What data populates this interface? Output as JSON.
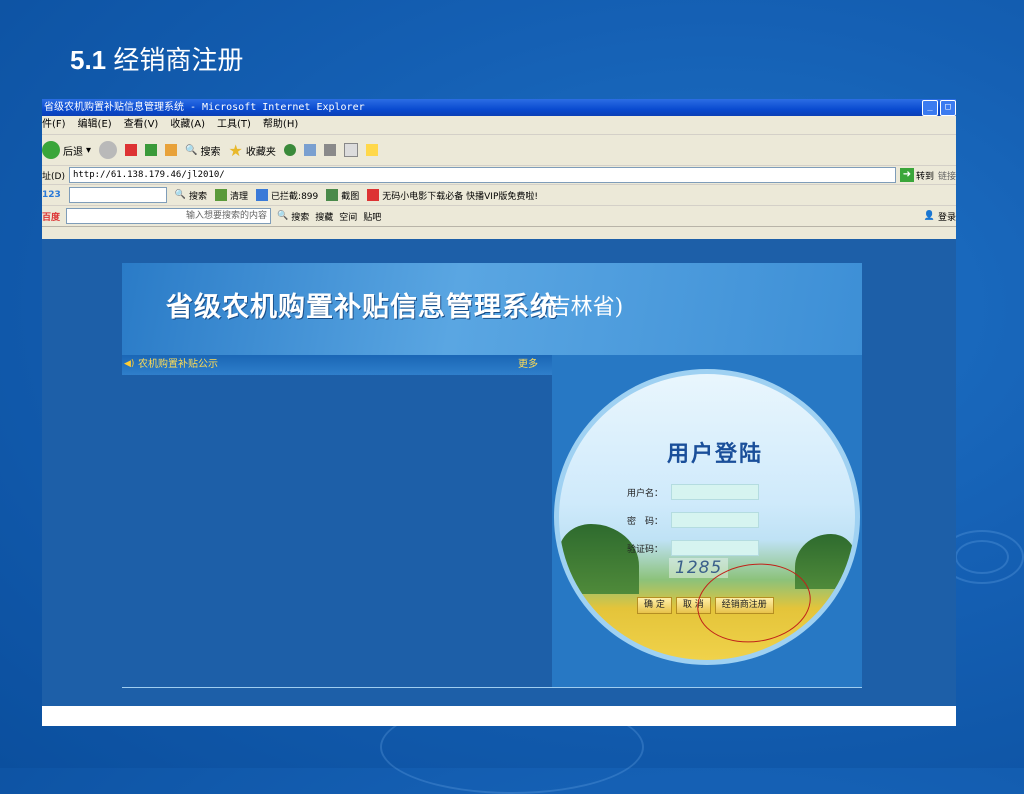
{
  "slide": {
    "title_num": "5.1",
    "title_text": "经销商注册"
  },
  "browser": {
    "window_title": "省级农机购置补贴信息管理系统 - Microsoft Internet Explorer",
    "menu": [
      "件(F)",
      "编辑(E)",
      "查看(V)",
      "收藏(A)",
      "工具(T)",
      "帮助(H)"
    ],
    "toolbar": {
      "back": "后退",
      "search": "搜索",
      "favorites": "收藏夹"
    },
    "address": {
      "label": "址(D)",
      "url": "http://61.138.179.46/jl2010/",
      "go": "转到",
      "links": "链接"
    },
    "bar3": {
      "search": "搜索",
      "clean": "清理",
      "blocked": "已拦截:899",
      "screenshot": "截图",
      "promo": "无码小电影下载必备 快播VIP版免费啦!"
    },
    "bar4": {
      "placeholder": "输入想要搜索的内容",
      "search": "搜索",
      "collect": "搜藏",
      "space": "空间",
      "tieba": "贴吧",
      "login": "登录"
    }
  },
  "page": {
    "banner_title": "省级农机购置补贴信息管理系统",
    "banner_province": "(吉林省)",
    "notice_label": "农机购置补贴公示",
    "notice_more": "更多",
    "login": {
      "title": "用户登陆",
      "username_label": "用户名：",
      "password_label": "密　码：",
      "captcha_label": "验证码：",
      "captcha_value": "1285",
      "ok_button": "确 定",
      "cancel_button": "取 消",
      "register_button": "经销商注册"
    }
  },
  "colors": {
    "slide_bg": "#1560b4",
    "titlebar": "#0a4bd0",
    "accent_red": "#c0221a"
  }
}
